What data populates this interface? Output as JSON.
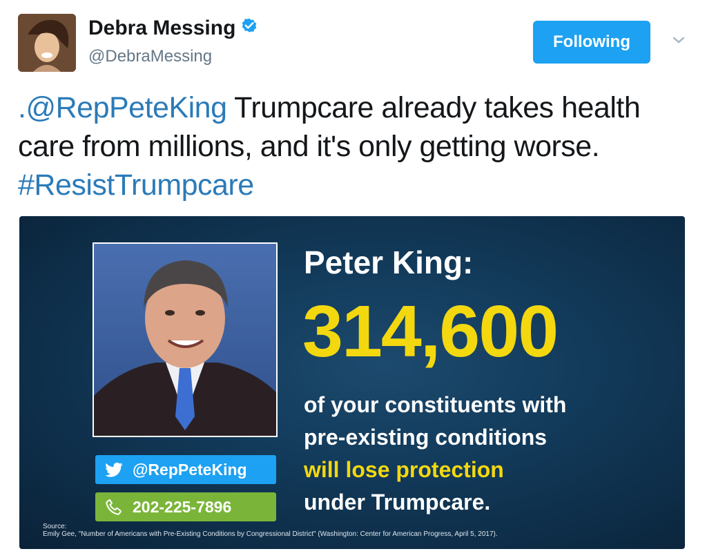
{
  "profile": {
    "name": "Debra Messing",
    "handle": "@DebraMessing",
    "follow_label": "Following"
  },
  "tweet": {
    "mention": ".@RepPeteKing",
    "text": " Trumpcare already takes health care from millions, and it's only getting worse. ",
    "hashtag": "#ResistTrumpcare"
  },
  "card": {
    "headline": "Peter King:",
    "number": "314,600",
    "line1": "of your constituents with",
    "line2": "pre-existing conditions",
    "line3": "will lose protection",
    "line4": "under Trumpcare.",
    "twitter_handle": "@RepPeteKing",
    "phone": "202-225-7896",
    "source_label": "Source:",
    "source_text": "Emily Gee, \"Number of Americans with Pre-Existing Conditions by Congressional District\" (Washington: Center for American Progress, April 5, 2017)."
  },
  "colors": {
    "twitter_blue": "#1da1f2",
    "link_blue": "#2b7bb9",
    "accent_yellow": "#f3d810",
    "phone_green": "#7ab539"
  },
  "icons": [
    "verified-badge-icon",
    "chevron-down-icon",
    "twitter-bird-icon",
    "phone-icon"
  ]
}
